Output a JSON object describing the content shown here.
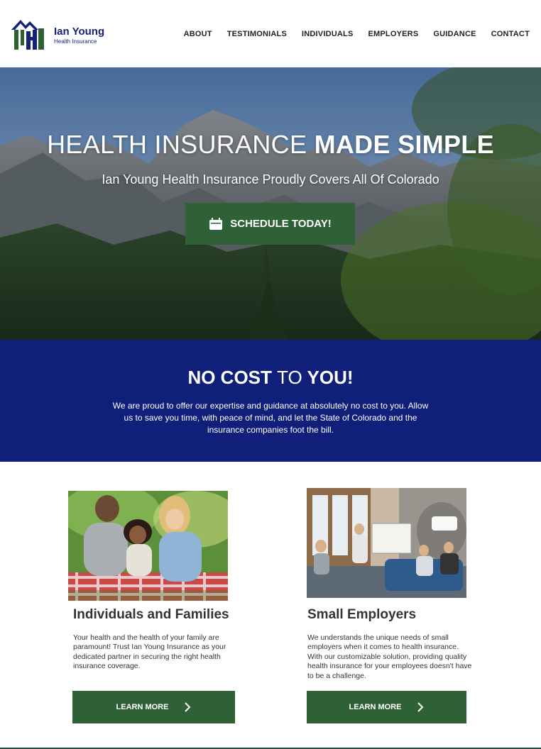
{
  "brand": {
    "name": "Ian Young",
    "tagline": "Health Insurance",
    "colors": {
      "navy": "#14237a",
      "green": "#2f6136",
      "band": "#0f1f7a"
    }
  },
  "nav": {
    "items": [
      "ABOUT",
      "TESTIMONIALS",
      "INDIVIDUALS",
      "EMPLOYERS",
      "GUIDANCE",
      "CONTACT"
    ]
  },
  "hero": {
    "title_light": "HEALTH INSURANCE",
    "title_bold": "MADE SIMPLE",
    "subtitle": "Ian Young Health Insurance Proudly Covers All Of Colorado",
    "cta_label": "SCHEDULE TODAY!",
    "cta_icon": "calendar-icon"
  },
  "band": {
    "title_part1": "NO COST",
    "title_part2": "TO",
    "title_part3": "YOU!",
    "text": "We are proud to offer our expertise and guidance at absolutely no cost to you. Allow us to save you time, with peace of mind, and let the State of Colorado and the insurance companies foot the bill."
  },
  "cards": [
    {
      "title": "Individuals and Families",
      "text": "Your health and the health of your family are paramount! Trust Ian Young Insurance as your dedicated partner in securing the right health insurance coverage.",
      "button": "LEARN MORE",
      "image": "family-photo"
    },
    {
      "title": "Small Employers",
      "text": "We understands the unique needs of small employers when it comes to health insurance. With our customizable solution, providing quality health insurance for your employees doesn't have to be a challenge.",
      "button": "LEARN MORE",
      "image": "office-team-photo"
    }
  ]
}
